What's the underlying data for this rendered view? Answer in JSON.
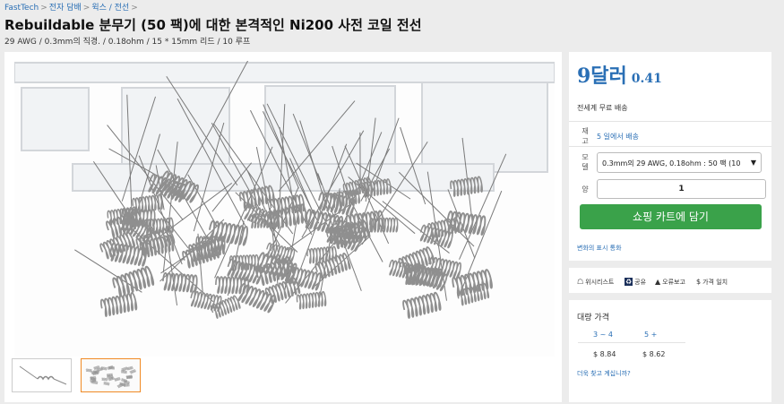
{
  "breadcrumb": {
    "items": [
      "FastTech",
      "전자 담배",
      "윅스 / 전선"
    ],
    "separator": ">"
  },
  "product": {
    "title": "Rebuildable 분무기 (50 팩)에 대한 본격적인 Ni200 사전 코일 전선",
    "subtitle": "29 AWG / 0.3mm의 직경. / 0.18ohm / 15 * 15mm 리드 / 10 루프"
  },
  "gallery": {
    "main_image_icon": "coil-wires-image",
    "thumbnails": [
      {
        "icon": "single-coil-thumbnail",
        "selected": false
      },
      {
        "icon": "coil-pile-thumbnail",
        "selected": true
      }
    ]
  },
  "buybox": {
    "price_main": "9달러",
    "price_cents": "0.41",
    "shipping": "전세계 무료 배송",
    "stock_label": "재고",
    "stock_value": "5 일에서 배송",
    "model_label": "모델",
    "model_value": "0.3mm의 29 AWG, 0.18ohm : 50 팩 (10",
    "qty_label": "양",
    "qty_value": "1",
    "cart_button": "쇼핑 카트에 담기",
    "currency_link": "변화의 표시 통화",
    "accent_color": "#2a6fb5",
    "button_color": "#3aa24a"
  },
  "actions": [
    {
      "icon": "wishlist-icon",
      "label": "위시리스트"
    },
    {
      "icon": "share-icon",
      "label": "공유"
    },
    {
      "icon": "warning-icon",
      "label": "오류보고"
    },
    {
      "icon": "dollar-icon",
      "label": "가격 일치"
    }
  ],
  "bulk": {
    "title": "대량 가격",
    "headers": [
      "3 ~ 4",
      "5 +"
    ],
    "prices": [
      "$ 8.84",
      "$ 8.62"
    ],
    "more_link": "더욱 찾고 계십니까?"
  }
}
